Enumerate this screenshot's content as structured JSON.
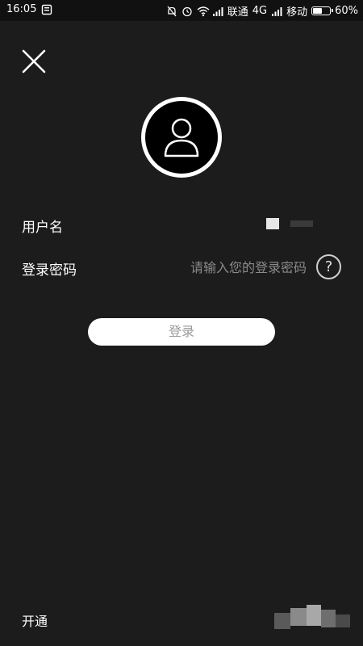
{
  "status_bar": {
    "time": "16:05",
    "carrier1": "联通",
    "network": "4G",
    "carrier2": "移动",
    "battery": "60%",
    "battery_level": 0.6
  },
  "header": {
    "close_icon": "close-icon"
  },
  "avatar": {
    "icon": "user-icon"
  },
  "form": {
    "username_label": "用户名",
    "password_label": "登录密码",
    "password_placeholder": "请输入您的登录密码",
    "help_label": "?"
  },
  "login_button": "登录",
  "footer": {
    "open_label": "开通"
  },
  "colors": {
    "background": "#1c1c1c",
    "status_bar": "#111111",
    "button_bg": "#ffffff",
    "button_text": "#9a9a9a"
  }
}
